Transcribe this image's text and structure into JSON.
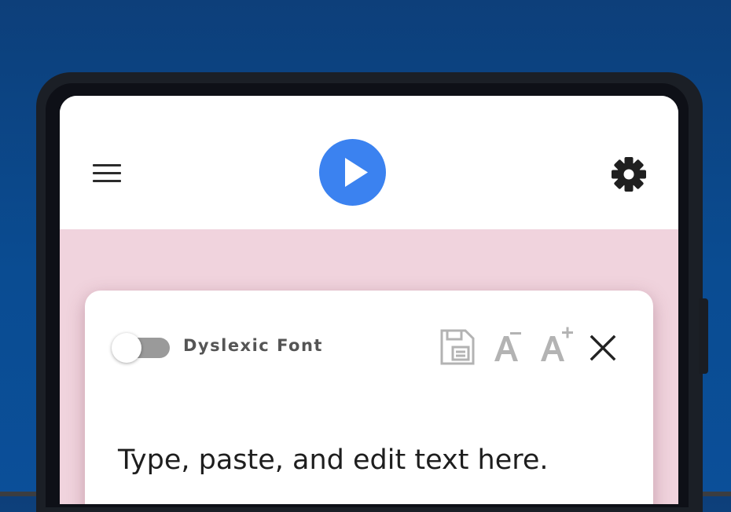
{
  "header": {
    "menu_icon": "hamburger-menu-icon",
    "play_icon": "play-icon",
    "settings_icon": "gear-icon"
  },
  "colors": {
    "background": "#0b4a90",
    "play_button": "#3b82f0",
    "content_background": "#f0d3dd",
    "toggle_track": "#9a9a9a",
    "tool_icon_disabled": "#b3b3b3"
  },
  "card": {
    "dyslexic_font": {
      "label": "Dyslexic Font",
      "enabled": false
    },
    "tools": [
      {
        "name": "save-icon",
        "icon": "save-document-icon"
      },
      {
        "name": "decrease-font-size",
        "icon": "font-decrease-icon",
        "glyph": "A",
        "modifier": "−"
      },
      {
        "name": "increase-font-size",
        "icon": "font-increase-icon",
        "glyph": "A",
        "modifier": "+"
      },
      {
        "name": "close",
        "icon": "close-icon"
      }
    ],
    "editor_placeholder": "Type, paste, and edit text here."
  }
}
